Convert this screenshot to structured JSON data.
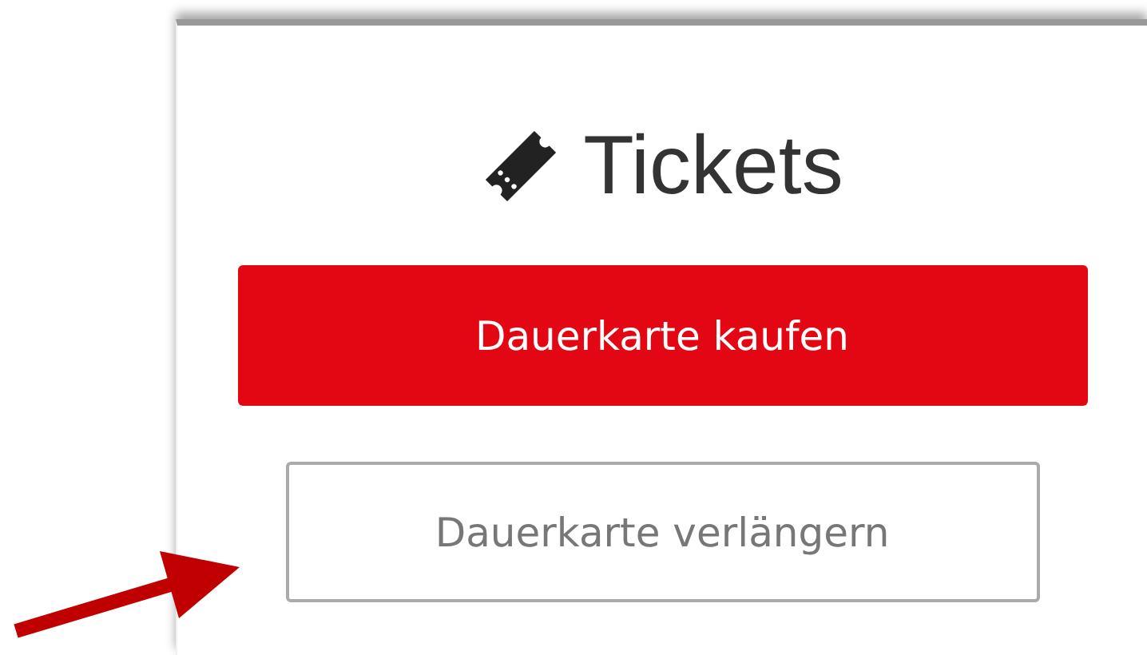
{
  "panel": {
    "title": "Tickets"
  },
  "buttons": [
    {
      "label": "Dauerkarte kaufen",
      "kind": "primary"
    },
    {
      "label": "Dauerkarte verlängern",
      "kind": "outline"
    }
  ]
}
